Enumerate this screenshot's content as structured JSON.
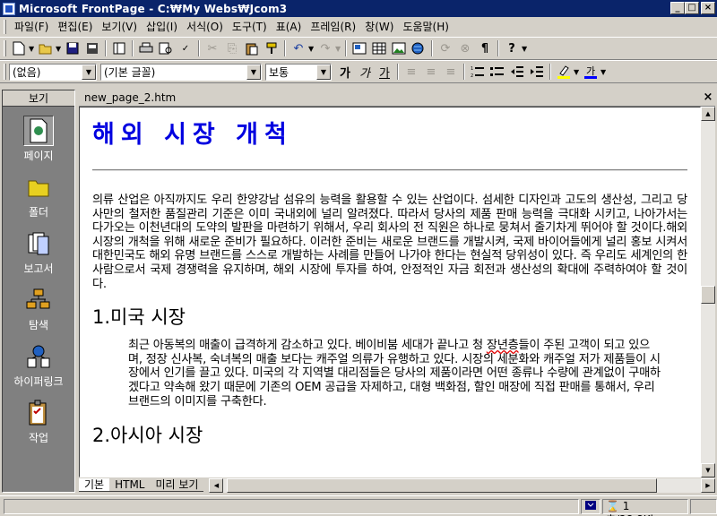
{
  "window": {
    "title": "Microsoft FrontPage - C:₩My Webs₩Jcom3"
  },
  "window_buttons": {
    "minimize": "_",
    "maximize": "□",
    "close": "×"
  },
  "menu": [
    "파일(F)",
    "편집(E)",
    "보기(V)",
    "삽입(I)",
    "서식(O)",
    "도구(T)",
    "표(A)",
    "프레임(R)",
    "창(W)",
    "도움말(H)"
  ],
  "toolbar2": {
    "style_value": "(없음)",
    "font_value": "(기본 글꼴)",
    "size_value": "보통",
    "bold": "가",
    "italic": "가",
    "underline": "가"
  },
  "views": {
    "header": "보기",
    "items": [
      "페이지",
      "폴더",
      "보고서",
      "탐색",
      "하이퍼링크",
      "작업"
    ]
  },
  "document": {
    "tab": "new_page_2.htm",
    "heading": "해외 시장 개척",
    "para1": "의류 산업은 아직까지도 우리 한양강남 섬유의 능력을 활용할 수 있는 산업이다. 섬세한 디자인과 고도의 생산성, 그리고 당사만의 철저한 품질관리 기준은 이미 국내외에 널리 알려졌다. 따라서 당사의 제품 판매 능력을 극대화 시키고, 나아가서는 다가오는 이천년대의 도약의 발판을 마련하기 위해서, 우리 회사의 전 직원은 하나로 뭉쳐서 줄기차게 뛰어야 할 것이다.해외시장의 개척을 위해 새로운 준비가 필요하다. 이러한 준비는 새로운 브랜드를 개발시켜, 국제 바이어들에게 널리 홍보 시켜서 대한민국도 해외 유명 브랜드를 스스로 개발하는 사례를 만들어 나가야 한다는 현실적 당위성이 있다. 즉 우리도 세계인의 한 사람으로서 국제 경쟁력을 유지하며, 해외 시장에 투자를 하여, 안정적인 자금 회전과 생산성의 확대에 주력하여야 할 것이다.",
    "section1": "1.미국 시장",
    "para2a": "최근 아동복의 매출이 급격하게 감소하고 있다. 베이비붐 세대가 끝나고 청 ",
    "para2b": "장년층",
    "para2c": "들이 주된 고객이 되고 있으며, 정장 신사복, 숙녀복의 매출 보다는 캐주얼 의류가 유행하고 있다. 시장의 세분화와 캐주얼 저가 제품들이 시장에서 인기를 끌고 있다. 미국의 각 지역별 대리점들은 당사의 제품이라면 어떤 종류나 수량에 관계없이 구매하겠다고 약속해 왔기 때문에 기존의 OEM 공급을 자제하고, 대형 백화점, 할인 매장에 직접 판매를 통해서, 우리 브랜드의 이미지를 구축한다.",
    "section2": "2.아시아 시장"
  },
  "view_tabs": [
    "기본",
    "HTML",
    "미리 보기"
  ],
  "status": {
    "speed": "1초/28.8Kbp"
  }
}
